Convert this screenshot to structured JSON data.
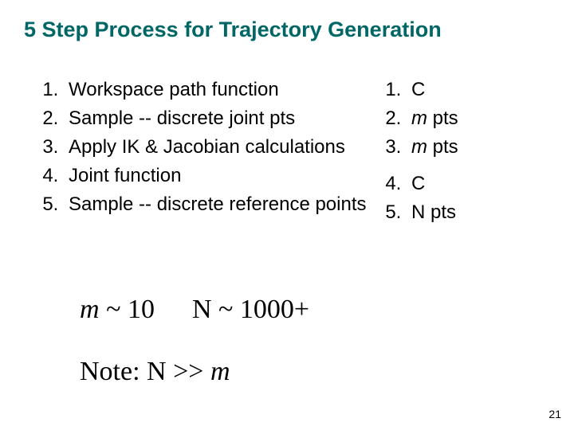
{
  "title": "5 Step Process for Trajectory Generation",
  "left_steps": {
    "s1": "Workspace path function",
    "s2": "Sample --  discrete joint pts",
    "s3": "Apply IK & Jacobian calculations",
    "s4": "Joint function",
    "s5": "Sample -- discrete reference points"
  },
  "right_steps": {
    "o1_pre": "C",
    "o2_m": "m",
    "o2_post": " pts",
    "o3_m": "m",
    "o3_post": " pts",
    "o4_pre": "C",
    "o5_pre": "N pts"
  },
  "approx": {
    "m_var": "m",
    "m_rel": " ~ 10",
    "n_var": "N",
    "n_rel": " ~ 1000+"
  },
  "note": {
    "prefix": "Note: N >> ",
    "m": "m"
  },
  "page_number": "21"
}
